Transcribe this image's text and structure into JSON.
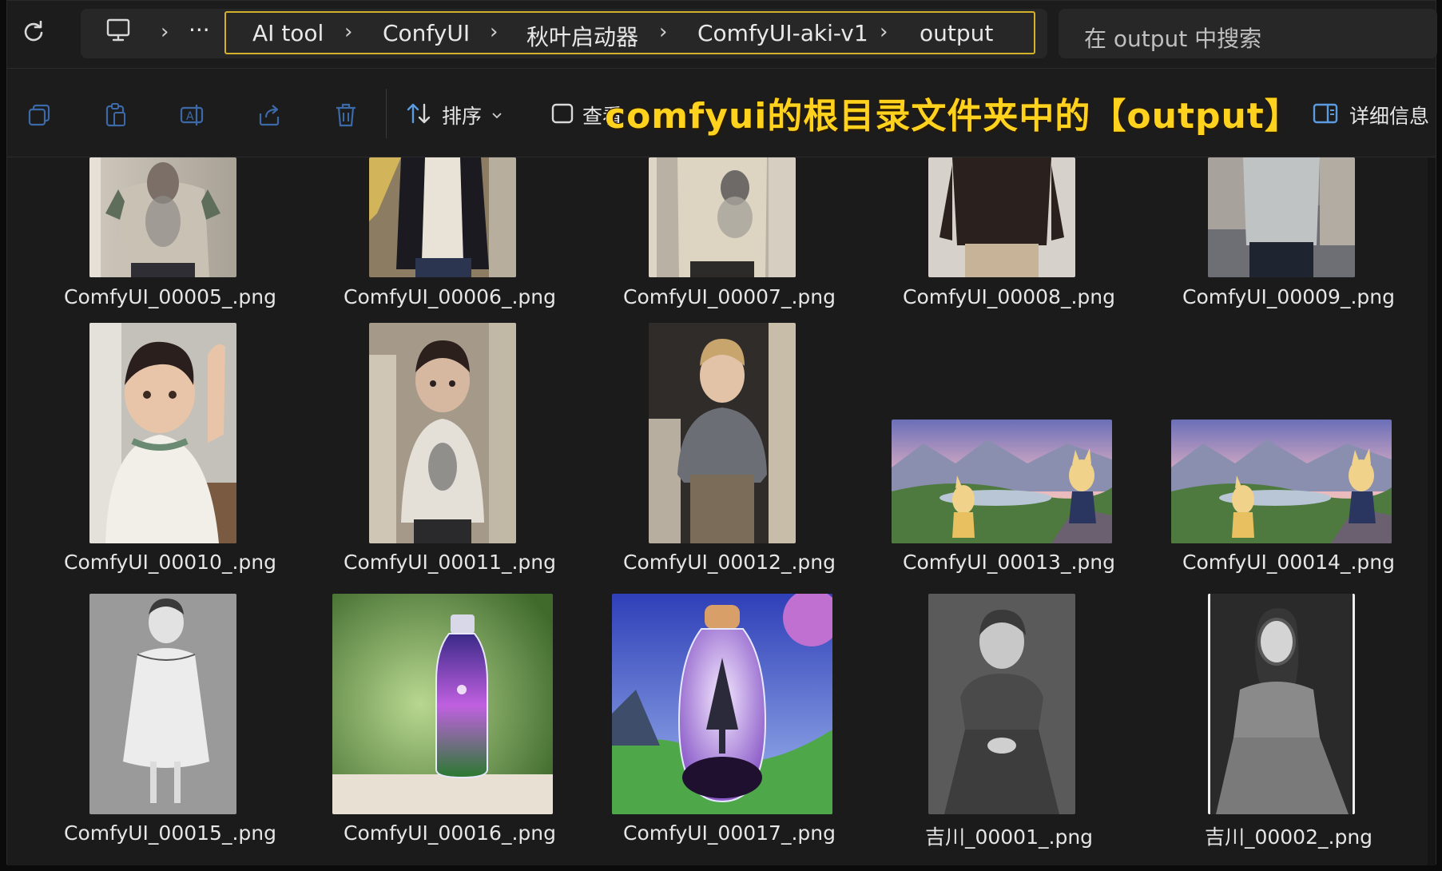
{
  "address_bar": {
    "ellipsis": "···",
    "breadcrumbs": [
      "AI tool",
      "ConfyUI",
      "秋叶启动器",
      "ComfyUI-aki-v1",
      "output"
    ],
    "separator": "›",
    "search_placeholder": "在 output 中搜索"
  },
  "toolbar": {
    "sort_label": "排序",
    "view_label": "查看",
    "details_label": "详细信息"
  },
  "overlay_caption": "comfyui的根目录文件夹中的【output】",
  "files": [
    {
      "name": "ComfyUI_00005_.png",
      "subject": "boy-grey-tshirt"
    },
    {
      "name": "ComfyUI_00006_.png",
      "subject": "boy-black-cardigan"
    },
    {
      "name": "ComfyUI_00007_.png",
      "subject": "boy-print-tshirt"
    },
    {
      "name": "ComfyUI_00008_.png",
      "subject": "boy-black-sweater"
    },
    {
      "name": "ComfyUI_00009_.png",
      "subject": "boy-grey-shirt-street"
    },
    {
      "name": "ComfyUI_00010_.png",
      "subject": "boy-waving"
    },
    {
      "name": "ComfyUI_00011_.png",
      "subject": "boy-standing-room"
    },
    {
      "name": "ComfyUI_00012_.png",
      "subject": "blond-boy-grey-tshirt"
    },
    {
      "name": "ComfyUI_00013_.png",
      "subject": "anime-fox-girls-landscape"
    },
    {
      "name": "ComfyUI_00014_.png",
      "subject": "anime-fox-girls-landscape"
    },
    {
      "name": "ComfyUI_00015_.png",
      "subject": "girl-bw-dress"
    },
    {
      "name": "ComfyUI_00016_.png",
      "subject": "bottle-purple-galaxy"
    },
    {
      "name": "ComfyUI_00017_.png",
      "subject": "bottle-tree"
    },
    {
      "name": "吉川_00001_.png",
      "subject": "girl-bw-portrait"
    },
    {
      "name": "吉川_00002_.png",
      "subject": "girl-bw-seated"
    }
  ]
}
